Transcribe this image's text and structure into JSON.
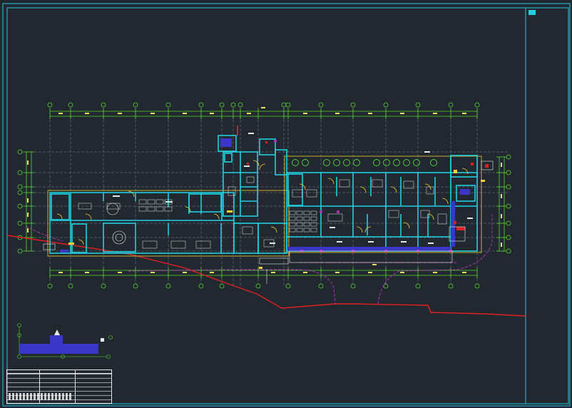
{
  "drawing": {
    "background": "#212830",
    "colors": {
      "frame": "#21c8dc",
      "wall": "#20d0e0",
      "grid": "#56d82f",
      "axis": "#9aa2a8",
      "fixture": "#e8e8e8",
      "door": "#f2d22c",
      "site_boundary": "#e02020",
      "path": "#c030c8",
      "fill": "#3a36c8",
      "plant": "#5ad040",
      "dim_text": "#e8e060"
    },
    "icons": [
      "north-arrow-icon",
      "tree-icon",
      "door-swing-icon"
    ]
  }
}
